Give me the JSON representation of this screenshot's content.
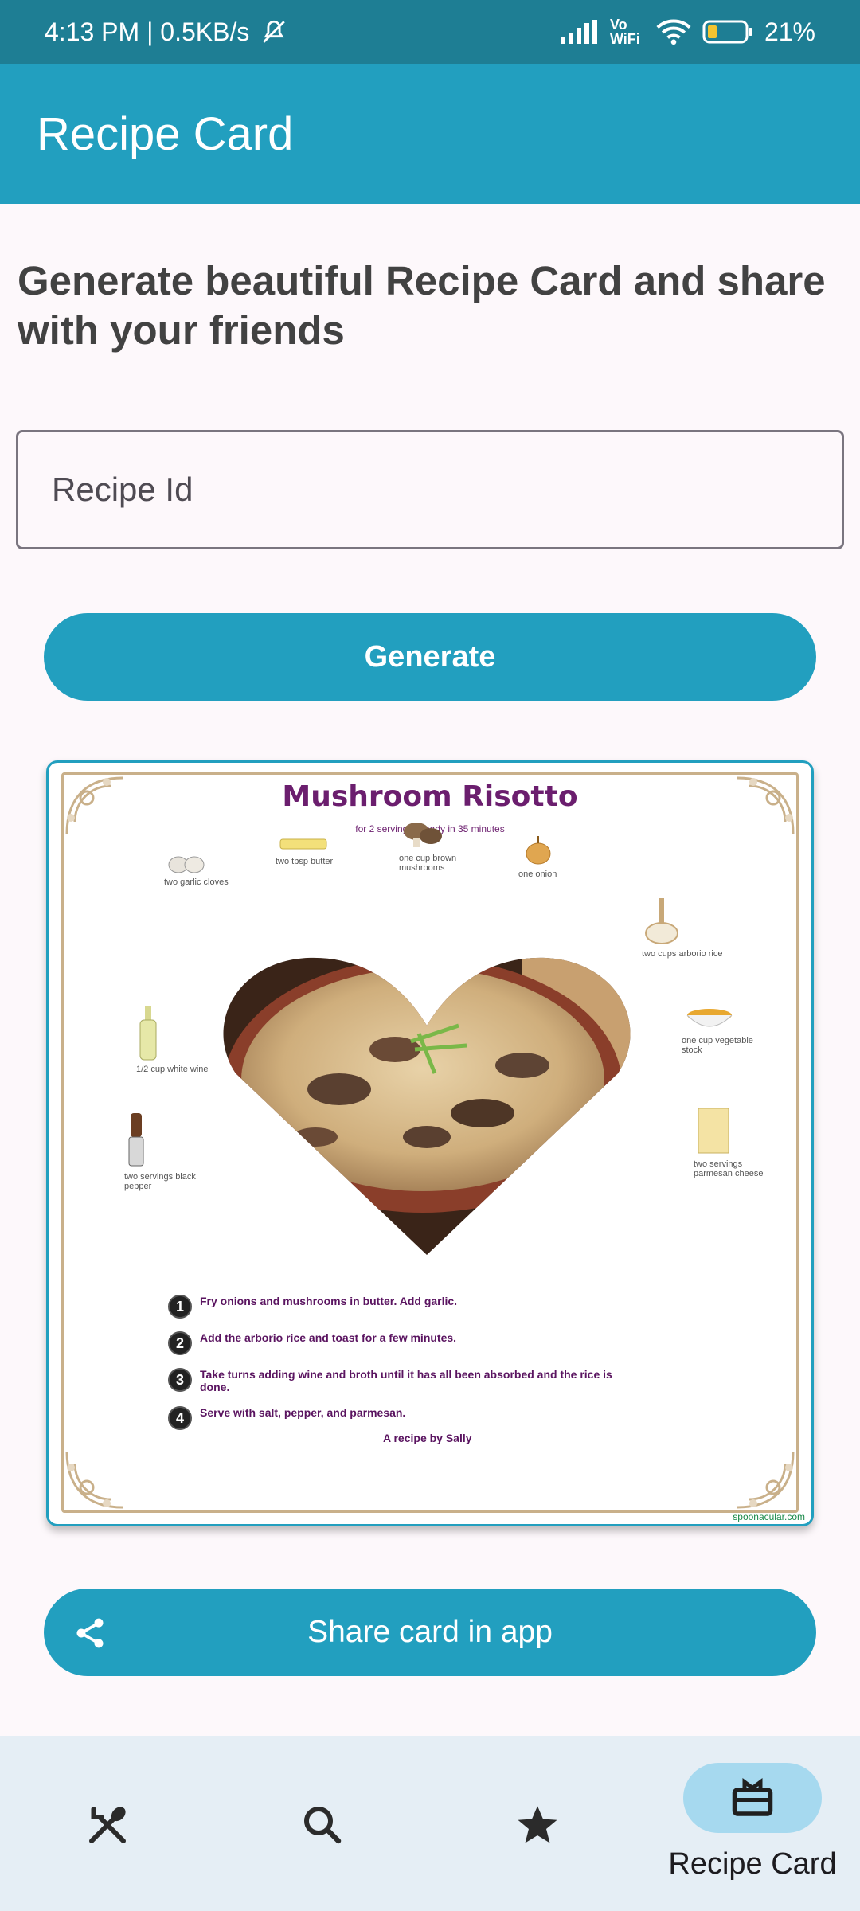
{
  "status_bar": {
    "time_speed": "4:13 PM | 0.5KB/s",
    "network_label": "Vo WiFi",
    "battery": "21%"
  },
  "app_bar": {
    "title": "Recipe Card"
  },
  "main": {
    "headline": "Generate beautiful Recipe Card and share with your friends",
    "recipe_input": {
      "placeholder": "Recipe Id",
      "value": ""
    },
    "generate_label": "Generate",
    "share_label": "Share card in app"
  },
  "card": {
    "title": "Mushroom Risotto",
    "subtitle": "for 2 servings - ready in 35 minutes",
    "ingredients": [
      "two garlic cloves",
      "two tbsp butter",
      "one cup brown mushrooms",
      "one onion",
      "two cups arborio rice",
      "1/2 cup white wine",
      "one cup vegetable stock",
      "two servings black pepper",
      "two servings parmesan cheese"
    ],
    "steps": [
      {
        "num": "1",
        "text": "Fry onions and mushrooms in butter. Add garlic."
      },
      {
        "num": "2",
        "text": "Add the arborio rice and toast for a few minutes."
      },
      {
        "num": "3",
        "text": "Take turns adding wine and broth until it has all been absorbed and the rice is done."
      },
      {
        "num": "4",
        "text": "Serve with salt, pepper, and parmesan."
      }
    ],
    "byline": "A recipe by Sally",
    "watermark": "spoonacular.com"
  },
  "bottom_nav": {
    "items": [
      {
        "icon": "fork-spoon-icon",
        "label": ""
      },
      {
        "icon": "search-icon",
        "label": ""
      },
      {
        "icon": "star-icon",
        "label": ""
      },
      {
        "icon": "recipe-card-icon",
        "label": "Recipe Card",
        "selected": true
      }
    ]
  },
  "colors": {
    "accent": "#229fbf",
    "status_bar": "#1e7e94",
    "nav_background": "#e5eef5",
    "nav_indicator": "#a6d9ef",
    "card_title": "#6b1e6e"
  }
}
